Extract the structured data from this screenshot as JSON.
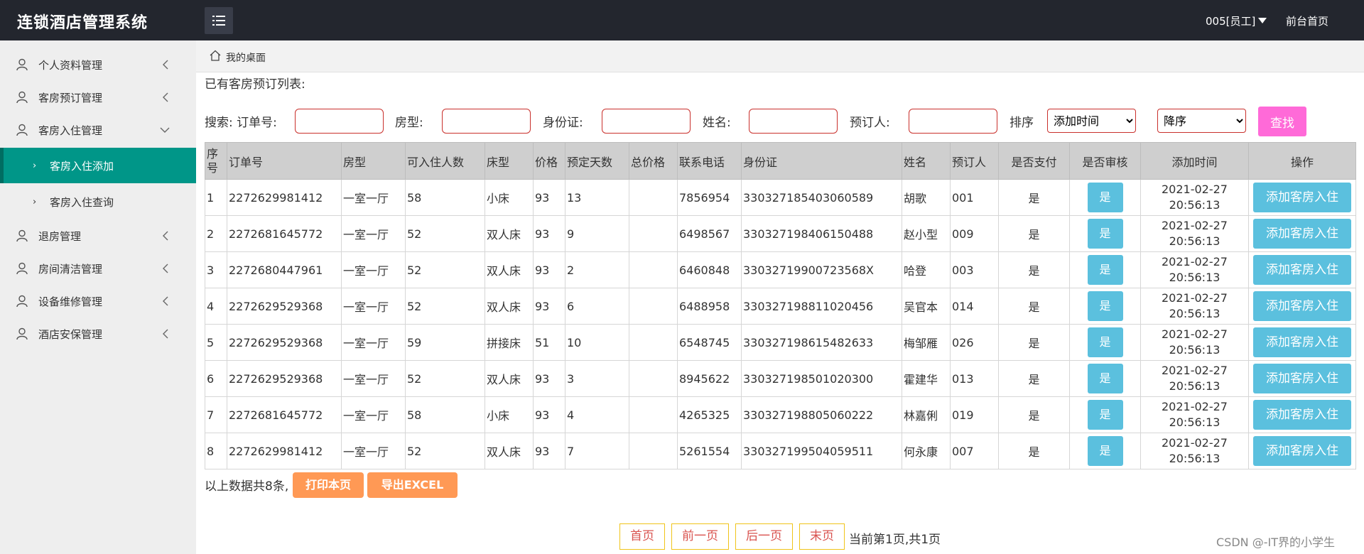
{
  "app": {
    "title": "连锁酒店管理系统",
    "user": "005[员工]",
    "front_link": "前台首页"
  },
  "sidebar": {
    "items": [
      {
        "label": "个人资料管理"
      },
      {
        "label": "客房预订管理"
      },
      {
        "label": "客房入住管理"
      },
      {
        "label": "客房入住添加"
      },
      {
        "label": "客房入住查询"
      },
      {
        "label": "退房管理"
      },
      {
        "label": "房间清洁管理"
      },
      {
        "label": "设备维修管理"
      },
      {
        "label": "酒店安保管理"
      }
    ]
  },
  "breadcrumb": {
    "label": "我的桌面"
  },
  "page": {
    "list_title": "已有客房预订列表:"
  },
  "search": {
    "prefix": "搜索: 订单号:",
    "room_type_label": "房型:",
    "id_label": "身份证:",
    "name_label": "姓名:",
    "booker_label": "预订人:",
    "sort_label": "排序",
    "sort_field": "添加时间",
    "sort_order": "降序",
    "button": "查找"
  },
  "table": {
    "headers": [
      "序号",
      "订单号",
      "房型",
      "可入住人数",
      "床型",
      "价格",
      "预定天数",
      "总价格",
      "联系电话",
      "身份证",
      "姓名",
      "预订人",
      "是否支付",
      "是否审核",
      "添加时间",
      "操作"
    ],
    "rows": [
      [
        "1",
        "2272629981412",
        "一室一厅",
        "58",
        "小床",
        "93",
        "13",
        "",
        "7856954",
        "330327185403060589",
        "胡歌",
        "001",
        "是",
        "是",
        "2021-02-27 20:56:13",
        "添加客房入住"
      ],
      [
        "2",
        "2272681645772",
        "一室一厅",
        "52",
        "双人床",
        "93",
        "9",
        "",
        "6498567",
        "330327198406150488",
        "赵小型",
        "009",
        "是",
        "是",
        "2021-02-27 20:56:13",
        "添加客房入住"
      ],
      [
        "3",
        "2272680447961",
        "一室一厅",
        "52",
        "双人床",
        "93",
        "2",
        "",
        "6460848",
        "33032719900723568X",
        "哈登",
        "003",
        "是",
        "是",
        "2021-02-27 20:56:13",
        "添加客房入住"
      ],
      [
        "4",
        "2272629529368",
        "一室一厅",
        "52",
        "双人床",
        "93",
        "6",
        "",
        "6488958",
        "330327198811020456",
        "吴官本",
        "014",
        "是",
        "是",
        "2021-02-27 20:56:13",
        "添加客房入住"
      ],
      [
        "5",
        "2272629529368",
        "一室一厅",
        "59",
        "拼接床",
        "51",
        "10",
        "",
        "6548745",
        "330327198615482633",
        "梅邹雁",
        "026",
        "是",
        "是",
        "2021-02-27 20:56:13",
        "添加客房入住"
      ],
      [
        "6",
        "2272629529368",
        "一室一厅",
        "52",
        "双人床",
        "93",
        "3",
        "",
        "8945622",
        "330327198501020300",
        "霍建华",
        "013",
        "是",
        "是",
        "2021-02-27 20:56:13",
        "添加客房入住"
      ],
      [
        "7",
        "2272681645772",
        "一室一厅",
        "58",
        "小床",
        "93",
        "4",
        "",
        "4265325",
        "330327198805060222",
        "林嘉俐",
        "019",
        "是",
        "是",
        "2021-02-27 20:56:13",
        "添加客房入住"
      ],
      [
        "8",
        "2272629981412",
        "一室一厅",
        "52",
        "双人床",
        "93",
        "7",
        "",
        "5261554",
        "330327199504059511",
        "何永康",
        "007",
        "是",
        "是",
        "2021-02-27 20:56:13",
        "添加客房入住"
      ]
    ]
  },
  "footer": {
    "summary": "以上数据共8条,",
    "print": "打印本页",
    "export": "导出EXCEL"
  },
  "pager": {
    "first": "首页",
    "prev": "前一页",
    "next": "后一页",
    "last": "末页",
    "info": "当前第1页,共1页"
  },
  "watermark": "CSDN @-IT界的小学生",
  "colors": {
    "topbar": "#23262e",
    "active_nav": "#009688",
    "accent_button": "#5bc0de",
    "search_button": "#ff6ad8",
    "orange_button": "#ff9955"
  }
}
